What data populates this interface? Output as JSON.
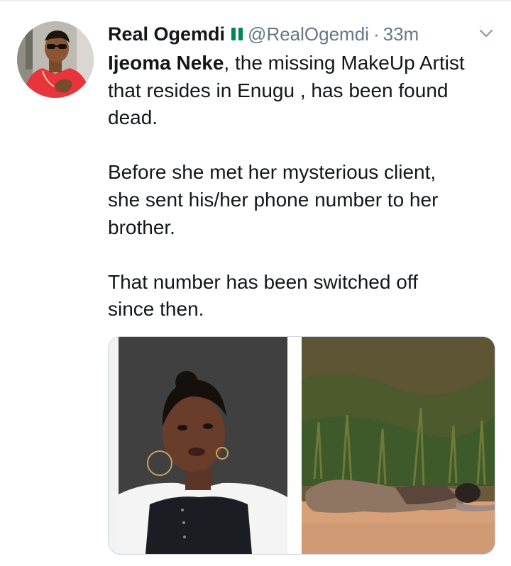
{
  "tweet": {
    "author_name": "Real Ogemdi",
    "author_handle": "@RealOgemdi",
    "separator": "·",
    "timestamp": "33m",
    "flag_icon": "nigeria-flag-icon",
    "menu_icon": "chevron-down-icon",
    "body": {
      "bold_name": "Ijeoma Neke",
      "line1_rest": ", the missing MakeUp Artist",
      "line2": "that resides in Enugu , has been found",
      "line3": "dead.",
      "paragraph2_line1": "Before she met her mysterious client,",
      "paragraph2_line2": "she sent his/her phone number to her",
      "paragraph2_line3": "brother.",
      "paragraph3_line1": "That number has been switched off",
      "paragraph3_line2": "since then."
    }
  },
  "colors": {
    "text": "#14171a",
    "muted": "#657786",
    "border": "#ccd6dd",
    "flag_green": "#008751"
  }
}
